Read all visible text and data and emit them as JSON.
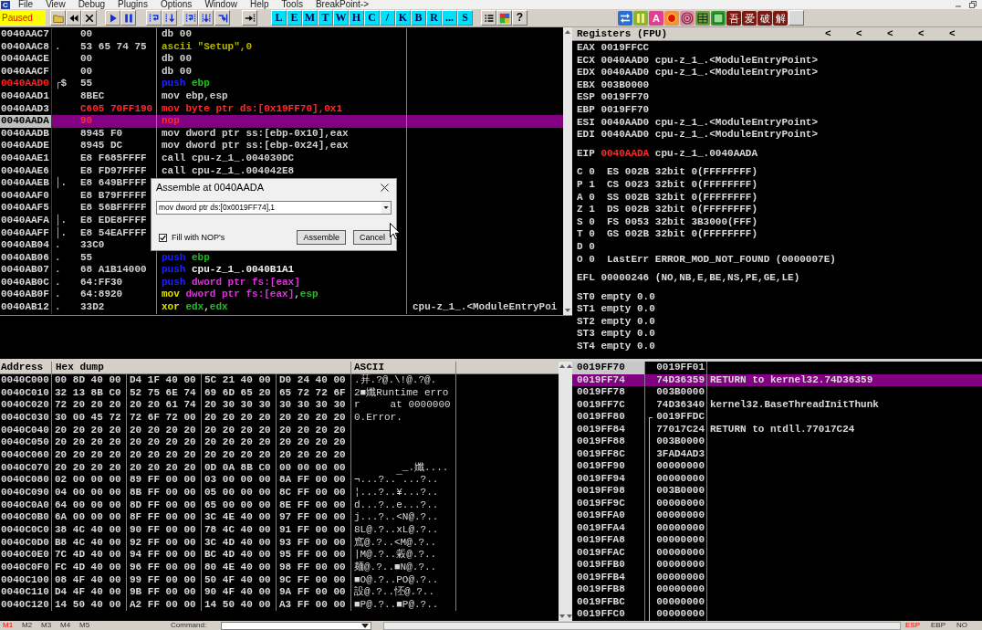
{
  "window": {
    "icon_letter": "C"
  },
  "menu": [
    "File",
    "View",
    "Debug",
    "Plugins",
    "Options",
    "Window",
    "Help",
    "Tools",
    "BreakPoint->"
  ],
  "toolbar": {
    "status": "Paused",
    "letters": [
      "L",
      "E",
      "M",
      "T",
      "W",
      "H",
      "C",
      "/",
      "K",
      "B",
      "R",
      "...",
      "S"
    ],
    "help": "?",
    "letter_tile": "A",
    "plugin_buttons": [
      "吾",
      "爱",
      "破",
      "解"
    ]
  },
  "disassembly": {
    "rows": [
      {
        "address": "0040AAC7",
        "hex": "00",
        "code": [
          {
            "text": "db 00"
          }
        ],
        "current": false,
        "selected": false,
        "modified": false,
        "address_highlight": false
      },
      {
        "address": "0040AAC8",
        "marker": ".",
        "hex": "53 65 74 75",
        "code": [
          {
            "text": "ascii \"Setup\",0",
            "color": "#b4b400"
          }
        ],
        "current": false,
        "selected": false,
        "modified": false,
        "address_highlight": false
      },
      {
        "address": "0040AACE",
        "hex": "00",
        "code": [
          {
            "text": "db 00"
          }
        ],
        "current": false,
        "selected": false,
        "modified": false,
        "address_highlight": false
      },
      {
        "address": "0040AACF",
        "hex": "00",
        "code": [
          {
            "text": "db 00"
          }
        ],
        "current": false,
        "selected": false,
        "modified": false,
        "address_highlight": false
      },
      {
        "address": "0040AAD0",
        "marker": "┌$",
        "hex": "55",
        "code": [
          {
            "text": "push",
            "color": "#2020ff"
          },
          {
            "text": " ebp",
            "color": "#20c020"
          }
        ],
        "current": false,
        "selected": false,
        "modified": false,
        "address_highlight": true
      },
      {
        "address": "0040AAD1",
        "hex": "8BEC",
        "code": [
          {
            "text": "mov ebp,esp"
          }
        ],
        "current": false,
        "selected": false,
        "modified": false,
        "address_highlight": false
      },
      {
        "address": "0040AAD3",
        "hex": "C605 70FF190",
        "code": [
          {
            "text": "mov byte ptr ds:[0x19FF70],0x1"
          }
        ],
        "current": false,
        "selected": false,
        "modified": true,
        "address_highlight": false
      },
      {
        "address": "0040AADA",
        "hex": "90",
        "code": [
          {
            "text": "nop"
          }
        ],
        "current": true,
        "selected": true,
        "modified": true,
        "address_highlight": false
      },
      {
        "address": "0040AADB",
        "hex": "8945 F0",
        "code": [
          {
            "text": "mov dword ptr ss:[ebp-0x10],eax"
          }
        ],
        "current": false,
        "selected": false,
        "modified": false,
        "address_highlight": false
      },
      {
        "address": "0040AADE",
        "hex": "8945 DC",
        "code": [
          {
            "text": "mov dword ptr ss:[ebp-0x24],eax"
          }
        ],
        "current": false,
        "selected": false,
        "modified": false,
        "address_highlight": false
      },
      {
        "address": "0040AAE1",
        "hex": "E8 F685FFFF",
        "code": [
          {
            "text": "call cpu-z_1_.004030DC"
          }
        ],
        "current": false,
        "selected": false,
        "modified": false,
        "address_highlight": false
      },
      {
        "address": "0040AAE6",
        "hex": "E8 FD97FFFF",
        "code": [
          {
            "text": "call cpu-z_1_.004042E8"
          }
        ],
        "current": false,
        "selected": false,
        "modified": false,
        "address_highlight": false
      },
      {
        "address": "0040AAEB",
        "marker": "│.",
        "hex": "E8 649BFFFF",
        "current": false,
        "selected": false,
        "modified": false,
        "address_highlight": false
      },
      {
        "address": "0040AAF0",
        "hex": "E8 B79FFFFF",
        "current": false,
        "selected": false,
        "modified": false,
        "address_highlight": false
      },
      {
        "address": "0040AAF5",
        "hex": "E8 56BFFFFF",
        "current": false,
        "selected": false,
        "modified": false,
        "address_highlight": false
      },
      {
        "address": "0040AAFA",
        "marker": "│.",
        "hex": "E8 EDE8FFFF",
        "current": false,
        "selected": false,
        "modified": false,
        "address_highlight": false
      },
      {
        "address": "0040AAFF",
        "marker": "│.",
        "hex": "E8 54EAFFFF",
        "current": false,
        "selected": false,
        "modified": false,
        "address_highlight": false
      },
      {
        "address": "0040AB04",
        "marker": ".",
        "hex": "33C0",
        "current": false,
        "selected": false,
        "modified": false,
        "address_highlight": false
      },
      {
        "address": "0040AB06",
        "marker": ".",
        "hex": "55",
        "code": [
          {
            "text": "push",
            "color": "#2020ff"
          },
          {
            "text": " ebp",
            "color": "#20c020"
          }
        ],
        "current": false,
        "selected": false,
        "modified": false,
        "address_highlight": false
      },
      {
        "address": "0040AB07",
        "marker": ".",
        "hex": "68 A1B14000",
        "code": [
          {
            "text": "push",
            "color": "#2020ff"
          },
          {
            "text": " cpu-z_1_.0040B1A1",
            "color": "#f0f0f0"
          }
        ],
        "current": false,
        "selected": false,
        "modified": false,
        "address_highlight": false
      },
      {
        "address": "0040AB0C",
        "marker": ".",
        "hex": "64:FF30",
        "code": [
          {
            "text": "push",
            "color": "#2020ff"
          },
          {
            "text": " dword ptr fs:[eax]",
            "color": "#e030e0"
          }
        ],
        "current": false,
        "selected": false,
        "modified": false,
        "address_highlight": false
      },
      {
        "address": "0040AB0F",
        "marker": ".",
        "hex": "64:8920",
        "code": [
          {
            "text": "mov",
            "color": "#e0e000"
          },
          {
            "text": " dword ptr fs:[eax]",
            "color": "#e030e0"
          },
          {
            "text": ","
          },
          {
            "text": "esp",
            "color": "#20c020"
          }
        ],
        "current": false,
        "selected": false,
        "modified": false,
        "address_highlight": false
      },
      {
        "address": "0040AB12",
        "marker": ".",
        "hex": "33D2",
        "code": [
          {
            "text": "xor",
            "color": "#e0e000"
          },
          {
            "text": " edx",
            "color": "#20c020"
          },
          {
            "text": ","
          },
          {
            "text": "edx",
            "color": "#20c020"
          }
        ],
        "comment": "cpu-z_1_.<ModuleEntryPoi",
        "current": false,
        "selected": false,
        "modified": false,
        "address_highlight": false
      }
    ]
  },
  "assemble_dialog": {
    "title": "Assemble at 0040AADA",
    "instruction": "mov dword ptr ds:[0x0019FF74],1",
    "fill_with_nops": {
      "label": "Fill with NOP's",
      "checked": true
    },
    "buttons": [
      "Assemble",
      "Cancel"
    ]
  },
  "registers": {
    "title": "Registers (FPU)",
    "arrows": [
      "<",
      "<",
      "<",
      "<",
      "<"
    ],
    "sections": [
      {
        "kind": "general",
        "lines": [
          {
            "name": "EAX",
            "value": "0019FFCC",
            "changed": false
          },
          {
            "name": "ECX",
            "value": "0040AAD0",
            "comment": "cpu-z_1_.<ModuleEntryPoint>",
            "changed": false
          },
          {
            "name": "EDX",
            "value": "0040AAD0",
            "comment": "cpu-z_1_.<ModuleEntryPoint>",
            "changed": false
          },
          {
            "name": "EBX",
            "value": "003B0000",
            "changed": false
          },
          {
            "name": "ESP",
            "value": "0019FF70",
            "changed": false
          },
          {
            "name": "EBP",
            "value": "0019FF70",
            "changed": false
          },
          {
            "name": "ESI",
            "value": "0040AAD0",
            "comment": "cpu-z_1_.<ModuleEntryPoint>",
            "changed": false
          },
          {
            "name": "EDI",
            "value": "0040AAD0",
            "comment": "cpu-z_1_.<ModuleEntryPoint>",
            "changed": false
          }
        ]
      },
      {
        "kind": "general",
        "lines": [
          {
            "name": "EIP",
            "value": "0040AADA",
            "comment": "cpu-z_1_.0040AADA",
            "changed": true
          }
        ]
      },
      {
        "kind": "flags",
        "lines": [
          {
            "name": "C",
            "value": "0",
            "comment": "ES 002B 32bit 0(FFFFFFFF)",
            "changed": false
          },
          {
            "name": "P",
            "value": "1",
            "comment": "CS 0023 32bit 0(FFFFFFFF)",
            "changed": false
          },
          {
            "name": "A",
            "value": "0",
            "comment": "SS 002B 32bit 0(FFFFFFFF)",
            "changed": false
          },
          {
            "name": "Z",
            "value": "1",
            "comment": "DS 002B 32bit 0(FFFFFFFF)",
            "changed": false
          },
          {
            "name": "S",
            "value": "0",
            "comment": "FS 0053 32bit 3B3000(FFF)",
            "changed": false
          },
          {
            "name": "T",
            "value": "0",
            "comment": "GS 002B 32bit 0(FFFFFFFF)",
            "changed": false
          },
          {
            "name": "D",
            "value": "0",
            "changed": false
          },
          {
            "name": "O",
            "value": "0",
            "comment": "LastErr ERROR_MOD_NOT_FOUND (0000007E)",
            "changed": false
          }
        ]
      },
      {
        "kind": "general",
        "lines": [
          {
            "name": "EFL",
            "value": "00000246",
            "comment": "(NO,NB,E,BE,NS,PE,GE,LE)",
            "changed": false
          }
        ]
      },
      {
        "kind": "general",
        "lines": [
          {
            "name": "ST0",
            "value": "empty",
            "comment": "0.0",
            "changed": false
          },
          {
            "name": "ST1",
            "value": "empty",
            "comment": "0.0",
            "changed": false
          },
          {
            "name": "ST2",
            "value": "empty",
            "comment": "0.0",
            "changed": false
          },
          {
            "name": "ST3",
            "value": "empty",
            "comment": "0.0",
            "changed": false
          },
          {
            "name": "ST4",
            "value": "empty",
            "comment": "0.0",
            "changed": false
          }
        ]
      }
    ]
  },
  "dump": {
    "columns": [
      "Address",
      "Hex dump",
      "ASCII"
    ],
    "rows": [
      {
        "address": "0040C000",
        "hex": [
          "00 8D 40 00",
          "D4 1F 40 00",
          "5C 21 40 00",
          "D0 24 40 00"
        ],
        "ascii": ".荓.?@.\\!@.?@."
      },
      {
        "address": "0040C010",
        "hex": [
          "32 13 8B C0",
          "52 75 6E 74",
          "69 6D 65 20",
          "65 72 72 6F"
        ],
        "ascii": "2■孅Runtime erro"
      },
      {
        "address": "0040C020",
        "hex": [
          "72 20 20 20",
          "20 20 61 74",
          "20 30 30 30",
          "30 30 30 30"
        ],
        "ascii": "r     at 0000000"
      },
      {
        "address": "0040C030",
        "hex": [
          "30 00 45 72",
          "72 6F 72 00",
          "20 20 20 20",
          "20 20 20 20"
        ],
        "ascii": "0.Error."
      },
      {
        "address": "0040C040",
        "hex": [
          "20 20 20 20",
          "20 20 20 20",
          "20 20 20 20",
          "20 20 20 20"
        ]
      },
      {
        "address": "0040C050",
        "hex": [
          "20 20 20 20",
          "20 20 20 20",
          "20 20 20 20",
          "20 20 20 20"
        ]
      },
      {
        "address": "0040C060",
        "hex": [
          "20 20 20 20",
          "20 20 20 20",
          "20 20 20 20",
          "20 20 20 20"
        ]
      },
      {
        "address": "0040C070",
        "hex": [
          "20 20 20 20",
          "20 20 20 20",
          "0D 0A 8B C0",
          "00 00 00 00"
        ],
        "ascii": "        _.孅...."
      },
      {
        "address": "0040C080",
        "hex": [
          "02 00 00 00",
          "89 FF 00 00",
          "03 00 00 00",
          "8A FF 00 00"
        ],
        "ascii": "¬...?..¯...?.."
      },
      {
        "address": "0040C090",
        "hex": [
          "04 00 00 00",
          "8B FF 00 00",
          "05 00 00 00",
          "8C FF 00 00"
        ],
        "ascii": "¦...?..¥...?.."
      },
      {
        "address": "0040C0A0",
        "hex": [
          "64 00 00 00",
          "8D FF 00 00",
          "65 00 00 00",
          "8E FF 00 00"
        ],
        "ascii": "d...?..e...?.."
      },
      {
        "address": "0040C0B0",
        "hex": [
          "6A 00 00 00",
          "8F FF 00 00",
          "3C 4E 40 00",
          "97 FF 00 00"
        ],
        "ascii": "j...?..<N@.?.."
      },
      {
        "address": "0040C0C0",
        "hex": [
          "38 4C 40 00",
          "90 FF 00 00",
          "78 4C 40 00",
          "91 FF 00 00"
        ],
        "ascii": "8L@.?..xL@.?.."
      },
      {
        "address": "0040C0D0",
        "hex": [
          "B8 4C 40 00",
          "92 FF 00 00",
          "3C 4D 40 00",
          "93 FF 00 00"
        ],
        "ascii": "窵@.?..<M@.?.."
      },
      {
        "address": "0040C0E0",
        "hex": [
          "7C 4D 40 00",
          "94 FF 00 00",
          "BC 4D 40 00",
          "95 FF 00 00"
        ],
        "ascii": "|M@.?..糓@.?.."
      },
      {
        "address": "0040C0F0",
        "hex": [
          "FC 4D 40 00",
          "96 FF 00 00",
          "80 4E 40 00",
          "98 FF 00 00"
        ],
        "ascii": "麺@.?..■N@.?.."
      },
      {
        "address": "0040C100",
        "hex": [
          "08 4F 40 00",
          "99 FF 00 00",
          "50 4F 40 00",
          "9C FF 00 00"
        ],
        "ascii": "■O@.?..PO@.?.."
      },
      {
        "address": "0040C110",
        "hex": [
          "D4 4F 40 00",
          "9B FF 00 00",
          "90 4F 40 00",
          "9A FF 00 00"
        ],
        "ascii": "設@.?..怌@.?.."
      },
      {
        "address": "0040C120",
        "hex": [
          "14 50 40 00",
          "A2 FF 00 00",
          "14 50 40 00",
          "A3 FF 00 00"
        ],
        "ascii": "■P@.?..■P@.?.."
      }
    ]
  },
  "stack": {
    "rows": [
      {
        "kind": "plain",
        "address": "0019FF70",
        "value": "0019FF01",
        "current": true,
        "selected": false
      },
      {
        "kind": "plain",
        "address": "0019FF74",
        "value": "74D36359",
        "comment": "RETURN to kernel32.74D36359",
        "current": false,
        "selected": true
      },
      {
        "kind": "plain",
        "address": "0019FF78",
        "value": "003B0000",
        "current": false,
        "selected": false
      },
      {
        "kind": "plain",
        "address": "0019FF7C",
        "value": "74D36340",
        "comment": "kernel32.BaseThreadInitThunk",
        "current": false,
        "selected": false
      },
      {
        "kind": "bracket_start",
        "address": "0019FF80",
        "value": "0019FFDC",
        "current": false,
        "selected": false
      },
      {
        "kind": "bracket_line",
        "address": "0019FF84",
        "value": "77017C24",
        "comment": "RETURN to ntdll.77017C24",
        "current": false,
        "selected": false
      },
      {
        "kind": "bracket_line",
        "address": "0019FF88",
        "value": "003B0000",
        "current": false,
        "selected": false
      },
      {
        "kind": "bracket_line",
        "address": "0019FF8C",
        "value": "3FAD4AD3",
        "current": false,
        "selected": false
      },
      {
        "kind": "bracket_line",
        "address": "0019FF90",
        "value": "00000000",
        "current": false,
        "selected": false
      },
      {
        "kind": "bracket_line",
        "address": "0019FF94",
        "value": "00000000",
        "current": false,
        "selected": false
      },
      {
        "kind": "bracket_line",
        "address": "0019FF98",
        "value": "003B0000",
        "current": false,
        "selected": false
      },
      {
        "kind": "bracket_line",
        "address": "0019FF9C",
        "value": "00000000",
        "current": false,
        "selected": false
      },
      {
        "kind": "bracket_line",
        "address": "0019FFA0",
        "value": "00000000",
        "current": false,
        "selected": false
      },
      {
        "kind": "bracket_line",
        "address": "0019FFA4",
        "value": "00000000",
        "current": false,
        "selected": false
      },
      {
        "kind": "bracket_line",
        "address": "0019FFA8",
        "value": "00000000",
        "current": false,
        "selected": false
      },
      {
        "kind": "bracket_line",
        "address": "0019FFAC",
        "value": "00000000",
        "current": false,
        "selected": false
      },
      {
        "kind": "bracket_line",
        "address": "0019FFB0",
        "value": "00000000",
        "current": false,
        "selected": false
      },
      {
        "kind": "bracket_line",
        "address": "0019FFB4",
        "value": "00000000",
        "current": false,
        "selected": false
      },
      {
        "kind": "bracket_line",
        "address": "0019FFB8",
        "value": "00000000",
        "current": false,
        "selected": false
      },
      {
        "kind": "bracket_line",
        "address": "0019FFBC",
        "value": "00000000",
        "current": false,
        "selected": false
      },
      {
        "kind": "bracket_line",
        "address": "0019FFC0",
        "value": "00000000",
        "current": false,
        "selected": false
      }
    ]
  },
  "bottom_bar": {
    "memory_tabs": [
      {
        "label": "M1",
        "selected": true
      },
      {
        "label": "M2",
        "selected": false
      },
      {
        "label": "M3",
        "selected": false
      },
      {
        "label": "M4",
        "selected": false
      },
      {
        "label": "M5",
        "selected": false
      }
    ],
    "command_label": "Command:",
    "register_tabs": [
      {
        "label": "ESP",
        "selected": true
      },
      {
        "label": "EBP",
        "selected": false
      },
      {
        "label": "NO",
        "selected": false
      }
    ]
  }
}
